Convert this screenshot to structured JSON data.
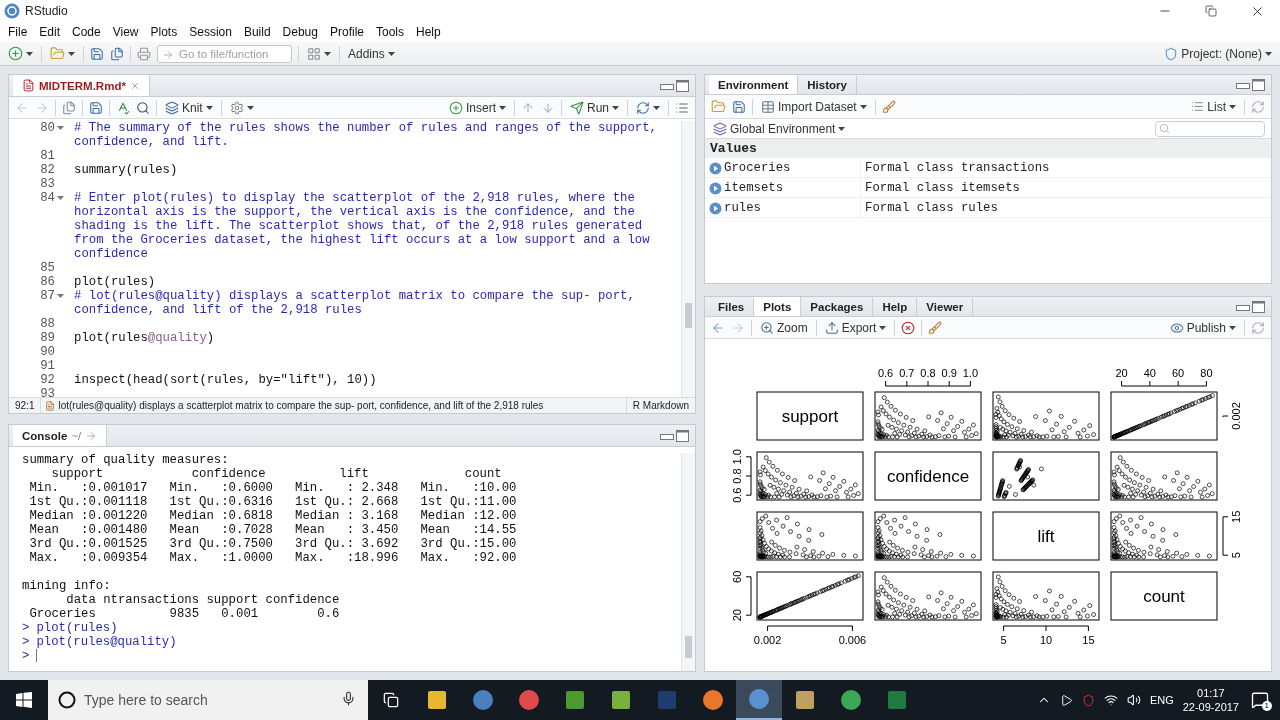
{
  "window": {
    "title": "RStudio"
  },
  "menu": [
    "File",
    "Edit",
    "Code",
    "View",
    "Plots",
    "Session",
    "Build",
    "Debug",
    "Profile",
    "Tools",
    "Help"
  ],
  "toolbar": {
    "search_placeholder": "Go to file/function",
    "addins": "Addins",
    "project": "Project: (None)"
  },
  "editor": {
    "tabs": [
      {
        "label": "MIDTERM.Rmd*",
        "selected": true
      }
    ],
    "toolbar": {
      "knit": "Knit",
      "insert": "Insert",
      "run": "Run"
    },
    "lines": [
      {
        "number": "80",
        "fold": true,
        "segments": [
          {
            "text": "# The summary of the rules shows the number of rules and ranges of the support, confidence, and lift.",
            "kind": "comment"
          }
        ]
      },
      {
        "number": "81",
        "fold": false
      },
      {
        "number": "82",
        "fold": false,
        "segments": [
          {
            "text": "summary(rules)",
            "kind": "code"
          }
        ]
      },
      {
        "number": "83",
        "fold": false
      },
      {
        "number": "84",
        "fold": true,
        "segments": [
          {
            "text": "# Enter plot(rules) to display the scatterplot of the 2,918 rules, where the horizontal axis is the support, the vertical axis is the confidence, and the shading is the lift. The scatterplot shows that, of the 2,918 rules generated from the Groceries dataset, the highest lift occurs at a low support and a low confidence",
            "kind": "comment"
          }
        ]
      },
      {
        "number": "85",
        "fold": false
      },
      {
        "number": "86",
        "fold": false,
        "segments": [
          {
            "text": "plot(rules)",
            "kind": "code"
          }
        ]
      },
      {
        "number": "87",
        "fold": true,
        "segments": [
          {
            "text": "# lot(rules@quality) displays a scatterplot matrix to compare the sup- port, confidence, and lift of the 2,918 rules",
            "kind": "comment"
          }
        ]
      },
      {
        "number": "88",
        "fold": false
      },
      {
        "number": "89",
        "fold": false,
        "segments": [
          {
            "text": "plot(rules",
            "kind": "code"
          },
          {
            "text": "@quality",
            "kind": "slot"
          },
          {
            "text": ")",
            "kind": "code"
          }
        ]
      },
      {
        "number": "90",
        "fold": false
      },
      {
        "number": "91",
        "fold": false
      },
      {
        "number": "92",
        "fold": false,
        "segments": [
          {
            "text": "inspect(head(sort(rules, by=\"lift\"), 10))",
            "kind": "code"
          }
        ]
      },
      {
        "number": "93",
        "fold": false
      }
    ],
    "status": {
      "position": "92:1",
      "section": "lot(rules@quality) displays a scatterplot matrix to compare the sup- port, confidence, and lift of the 2,918 rules",
      "mode": "R Markdown"
    }
  },
  "console": {
    "title": "Console",
    "path": "~/",
    "lines": [
      {
        "kind": "output",
        "text": "summary of quality measures:"
      },
      {
        "kind": "output",
        "text": "    support            confidence          lift             count"
      },
      {
        "kind": "output",
        "text": " Min.   :0.001017   Min.   :0.6000   Min.   : 2.348   Min.   :10.00"
      },
      {
        "kind": "output",
        "text": " 1st Qu.:0.001118   1st Qu.:0.6316   1st Qu.: 2.668   1st Qu.:11.00"
      },
      {
        "kind": "output",
        "text": " Median :0.001220   Median :0.6818   Median : 3.168   Median :12.00"
      },
      {
        "kind": "output",
        "text": " Mean   :0.001480   Mean   :0.7028   Mean   : 3.450   Mean   :14.55"
      },
      {
        "kind": "output",
        "text": " 3rd Qu.:0.001525   3rd Qu.:0.7500   3rd Qu.: 3.692   3rd Qu.:15.00"
      },
      {
        "kind": "output",
        "text": " Max.   :0.009354   Max.   :1.0000   Max.   :18.996   Max.   :92.00"
      },
      {
        "kind": "blank"
      },
      {
        "kind": "output",
        "text": "mining info:"
      },
      {
        "kind": "output",
        "text": "      data ntransactions support confidence"
      },
      {
        "kind": "output",
        "text": " Groceries          9835   0.001        0.6"
      },
      {
        "kind": "input",
        "prompt": ">",
        "text": "plot(rules)"
      },
      {
        "kind": "input",
        "prompt": ">",
        "text": "plot(rules@quality)"
      },
      {
        "kind": "input",
        "prompt": ">"
      }
    ]
  },
  "environment": {
    "tabs": [
      {
        "label": "Environment",
        "selected": true
      },
      {
        "label": "History",
        "selected": false
      }
    ],
    "import": "Import Dataset",
    "view": "List",
    "scope": "Global Environment",
    "section": "Values",
    "values": [
      {
        "name": "Groceries",
        "value": "Formal class transactions"
      },
      {
        "name": "itemsets",
        "value": "Formal class itemsets"
      },
      {
        "name": "rules",
        "value": "Formal class rules"
      }
    ]
  },
  "files": {
    "tabs": [
      {
        "label": "Files",
        "selected": false
      },
      {
        "label": "Plots",
        "selected": true
      },
      {
        "label": "Packages",
        "selected": false
      },
      {
        "label": "Help",
        "selected": false
      },
      {
        "label": "Viewer",
        "selected": false
      }
    ],
    "zoom": "Zoom",
    "export": "Export",
    "publish": "Publish",
    "plot": {
      "variables": [
        {
          "name": "support",
          "column_ticks": [
            "0.002",
            "0.006"
          ],
          "row_ticks": [
            "0.002"
          ]
        },
        {
          "name": "confidence",
          "column_ticks": [
            "0.6",
            "0.7",
            "0.8",
            "0.9",
            "1.0"
          ],
          "row_ticks": [
            "0.6",
            "0.8",
            "1.0"
          ]
        },
        {
          "name": "lift",
          "column_ticks": [
            "5",
            "10",
            "15"
          ],
          "row_ticks": [
            "5",
            "15"
          ]
        },
        {
          "name": "count",
          "column_ticks": [
            "20",
            "40",
            "60",
            "80"
          ],
          "row_ticks": [
            "20",
            "60"
          ]
        }
      ]
    }
  },
  "taskbar": {
    "search_placeholder": "Type here to search",
    "language": "ENG",
    "time": "01:17",
    "date": "22-09-2017",
    "notifications": "1"
  }
}
